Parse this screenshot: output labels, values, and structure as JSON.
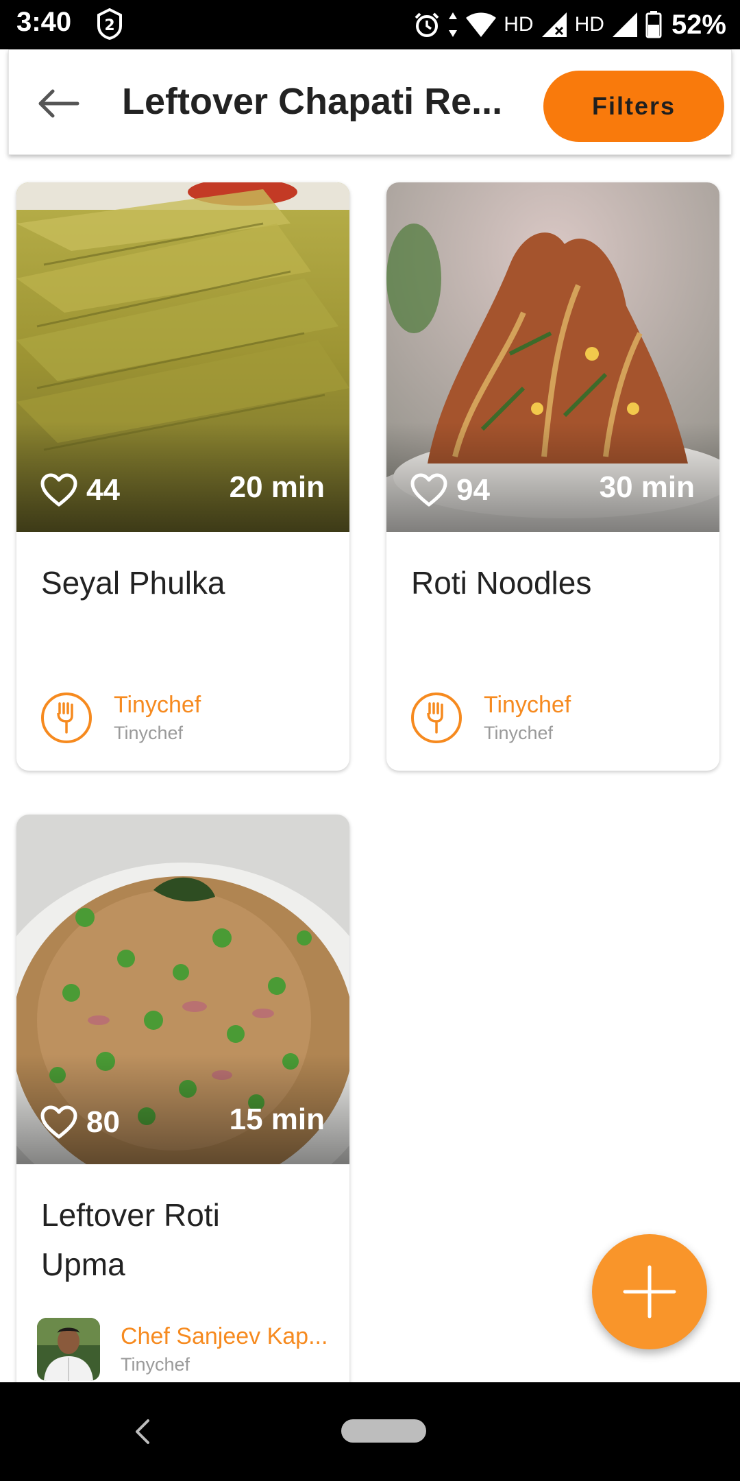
{
  "status_bar": {
    "time": "3:40",
    "notification_count": "2",
    "network_label_1": "HD",
    "network_label_2": "HD",
    "battery": "52%"
  },
  "app_bar": {
    "title": "Leftover Chapati Re...",
    "filters_label": "Filters"
  },
  "recipes": [
    {
      "title": "Seyal Phulka",
      "likes": "44",
      "duration": "20 min",
      "author": "Tinychef",
      "author_sub": "Tinychef"
    },
    {
      "title": "Roti Noodles",
      "likes": "94",
      "duration": "30 min",
      "author": "Tinychef",
      "author_sub": "Tinychef"
    },
    {
      "title": "Leftover Roti Upma",
      "likes": "80",
      "duration": "15 min",
      "author": "Chef Sanjeev Kap...",
      "author_sub": "Tinychef"
    }
  ],
  "colors": {
    "accent": "#f97a0c",
    "author_text": "#f68a1f",
    "fab": "#f9952a"
  },
  "icons": {
    "back": "arrow-left-icon",
    "like": "heart-icon",
    "author": "fork-hand-icon",
    "fab": "plus-icon"
  }
}
